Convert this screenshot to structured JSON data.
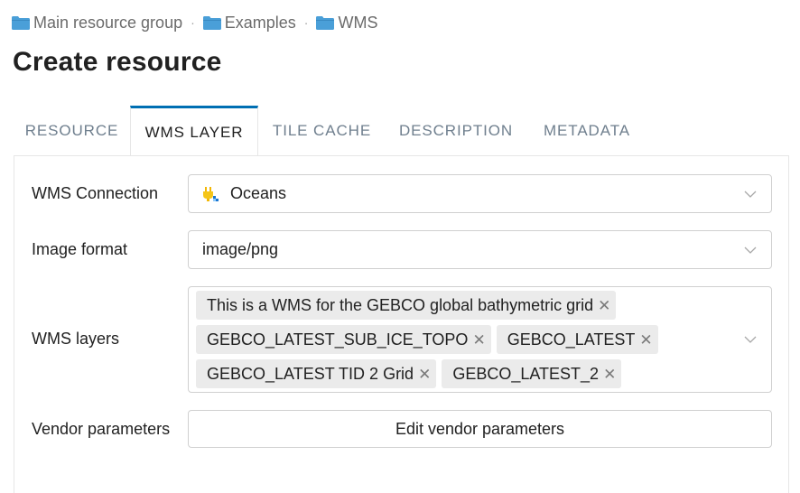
{
  "breadcrumb": {
    "items": [
      {
        "label": "Main resource group",
        "icon": "folder-icon"
      },
      {
        "label": "Examples",
        "icon": "folder-icon"
      },
      {
        "label": "WMS",
        "icon": "folder-icon"
      }
    ],
    "separator": "·"
  },
  "page": {
    "title": "Create resource"
  },
  "tabs": [
    {
      "label": "RESOURCE",
      "active": false
    },
    {
      "label": "WMS LAYER",
      "active": true
    },
    {
      "label": "TILE CACHE",
      "active": false
    },
    {
      "label": "DESCRIPTION",
      "active": false
    },
    {
      "label": "METADATA",
      "active": false
    }
  ],
  "form": {
    "connection": {
      "label": "WMS Connection",
      "value": "Oceans",
      "icon": "wms-connection-plug-icon"
    },
    "image_format": {
      "label": "Image format",
      "value": "image/png"
    },
    "layers": {
      "label": "WMS layers",
      "tags": [
        "This is a WMS for the GEBCO global bathymetric grid",
        "GEBCO_LATEST_SUB_ICE_TOPO",
        "GEBCO_LATEST",
        "GEBCO_LATEST TID 2 Grid",
        "GEBCO_LATEST_2"
      ]
    },
    "vendor": {
      "label": "Vendor parameters",
      "button_label": "Edit vendor parameters"
    }
  },
  "colors": {
    "accent": "#006fb3",
    "folder": "#4a9fd8",
    "tab_inactive": "#6f7f8e",
    "tag_bg": "#ebebeb"
  }
}
